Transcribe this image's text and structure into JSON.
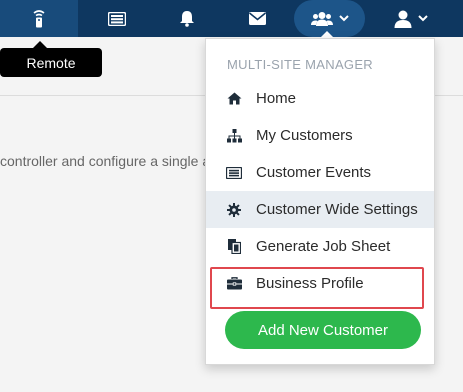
{
  "navbar": {
    "tooltip": "Remote",
    "icons": [
      "remote-icon",
      "list-icon",
      "bell-icon",
      "envelope-icon",
      "users-icon",
      "user-icon",
      "chevron-down-icon"
    ]
  },
  "background": {
    "text": "controller and configure a single a"
  },
  "menu": {
    "header": "MULTI-SITE MANAGER",
    "items": [
      {
        "label": "Home",
        "icon": "home-icon"
      },
      {
        "label": "My Customers",
        "icon": "sitemap-icon"
      },
      {
        "label": "Customer Events",
        "icon": "list-icon"
      },
      {
        "label": "Customer Wide Settings",
        "icon": "gear-icon"
      },
      {
        "label": "Generate Job Sheet",
        "icon": "copy-icon"
      },
      {
        "label": "Business Profile",
        "icon": "briefcase-icon"
      }
    ],
    "add_button": "Add New Customer"
  },
  "colors": {
    "navbar": "#0e3760",
    "accent_green": "#2db84d",
    "highlight_red": "#e0474e"
  }
}
